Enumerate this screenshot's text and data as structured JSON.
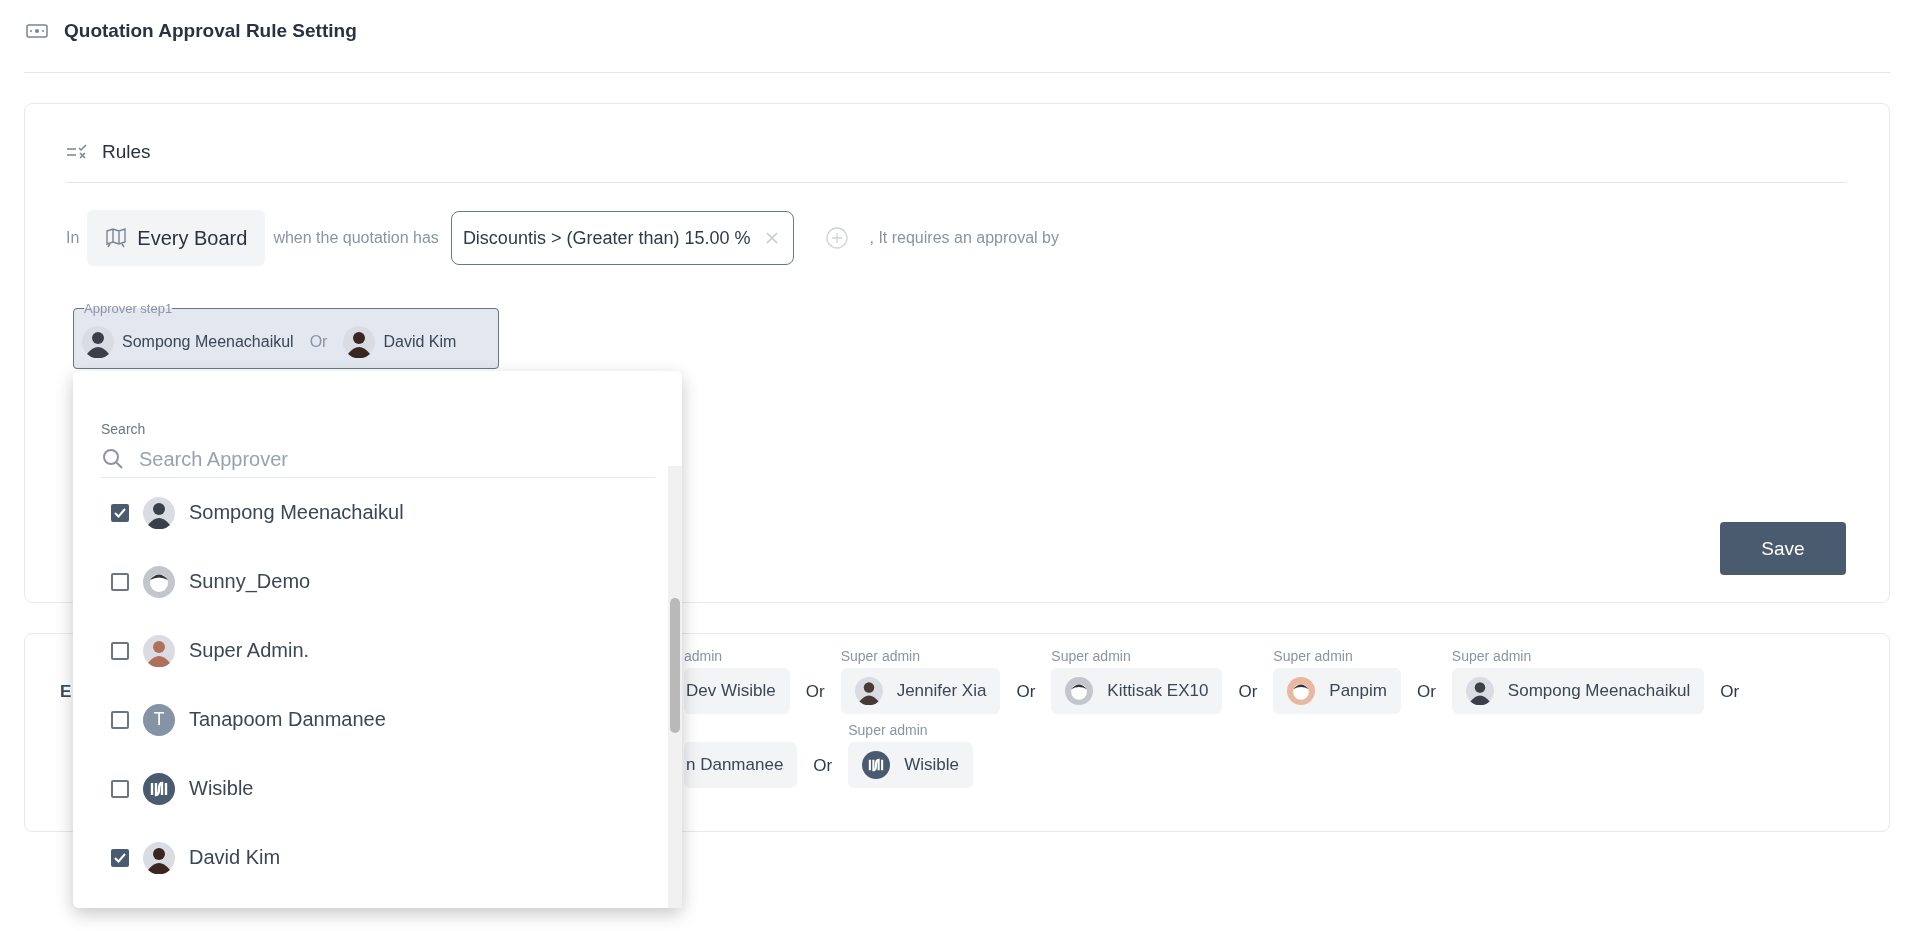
{
  "page": {
    "title": "Quotation Approval Rule Setting"
  },
  "rules": {
    "title": "Rules",
    "prefix": "In",
    "board": "Every Board",
    "connector": "when the quotation has",
    "condition": "Discountis > (Greater than) 15.00 %",
    "suffix": ", It requires an approval by",
    "approver_step": {
      "legend": "Approver step1",
      "separator": "Or",
      "approvers": [
        {
          "name": "Sompong Meenachaikul",
          "avatar": {
            "kind": "photo",
            "color": "#3b3f4a"
          }
        },
        {
          "name": "David Kim",
          "avatar": {
            "kind": "photo",
            "color": "#3a2520"
          }
        }
      ]
    },
    "save": "Save"
  },
  "dropdown": {
    "search_label": "Search",
    "placeholder": "Search Approver",
    "items": [
      {
        "name": "Sompong Meenachaikul",
        "checked": true,
        "avatar": {
          "kind": "photo",
          "color": "#3b3f4a"
        }
      },
      {
        "name": "Sunny_Demo",
        "checked": false,
        "avatar": {
          "kind": "cartoon",
          "color": "#c3c7cd"
        }
      },
      {
        "name": "Super Admin.",
        "checked": false,
        "avatar": {
          "kind": "photo",
          "color": "#b0715a"
        }
      },
      {
        "name": "Tanapoom Danmanee",
        "checked": false,
        "avatar": {
          "kind": "letter",
          "letter": "T",
          "color": "#8494a4"
        }
      },
      {
        "name": "Wisible",
        "checked": false,
        "avatar": {
          "kind": "logo",
          "color": "#4a5b70"
        }
      },
      {
        "name": "David Kim",
        "checked": true,
        "avatar": {
          "kind": "photo",
          "color": "#3a2520"
        }
      }
    ]
  },
  "approvers_card": {
    "heading": "E",
    "rows": [
      [
        {
          "label": "admin",
          "name": "Dev Wisible",
          "after": "Or",
          "cut": true
        },
        {
          "label": "Super admin",
          "name": "Jennifer Xia",
          "after": "Or",
          "avatar": {
            "kind": "photo",
            "color": "#4a3a35"
          }
        },
        {
          "label": "Super admin",
          "name": "Kittisak EX10",
          "after": "Or",
          "avatar": {
            "kind": "cartoon",
            "color": "#c3c7cd"
          }
        },
        {
          "label": "Super admin",
          "name": "Panpim",
          "after": "Or",
          "avatar": {
            "kind": "cartoon",
            "color": "#e8b9a0"
          }
        },
        {
          "label": "Super admin",
          "name": "Sompong Meenachaikul",
          "after": "Or",
          "avatar": {
            "kind": "photo",
            "color": "#3b3f4a"
          }
        }
      ],
      [
        {
          "name": "n Danmanee",
          "after": "Or",
          "cut": true
        },
        {
          "label": "Super admin",
          "name": "Wisible",
          "avatar": {
            "kind": "logo",
            "color": "#4a5b70"
          }
        }
      ]
    ]
  }
}
